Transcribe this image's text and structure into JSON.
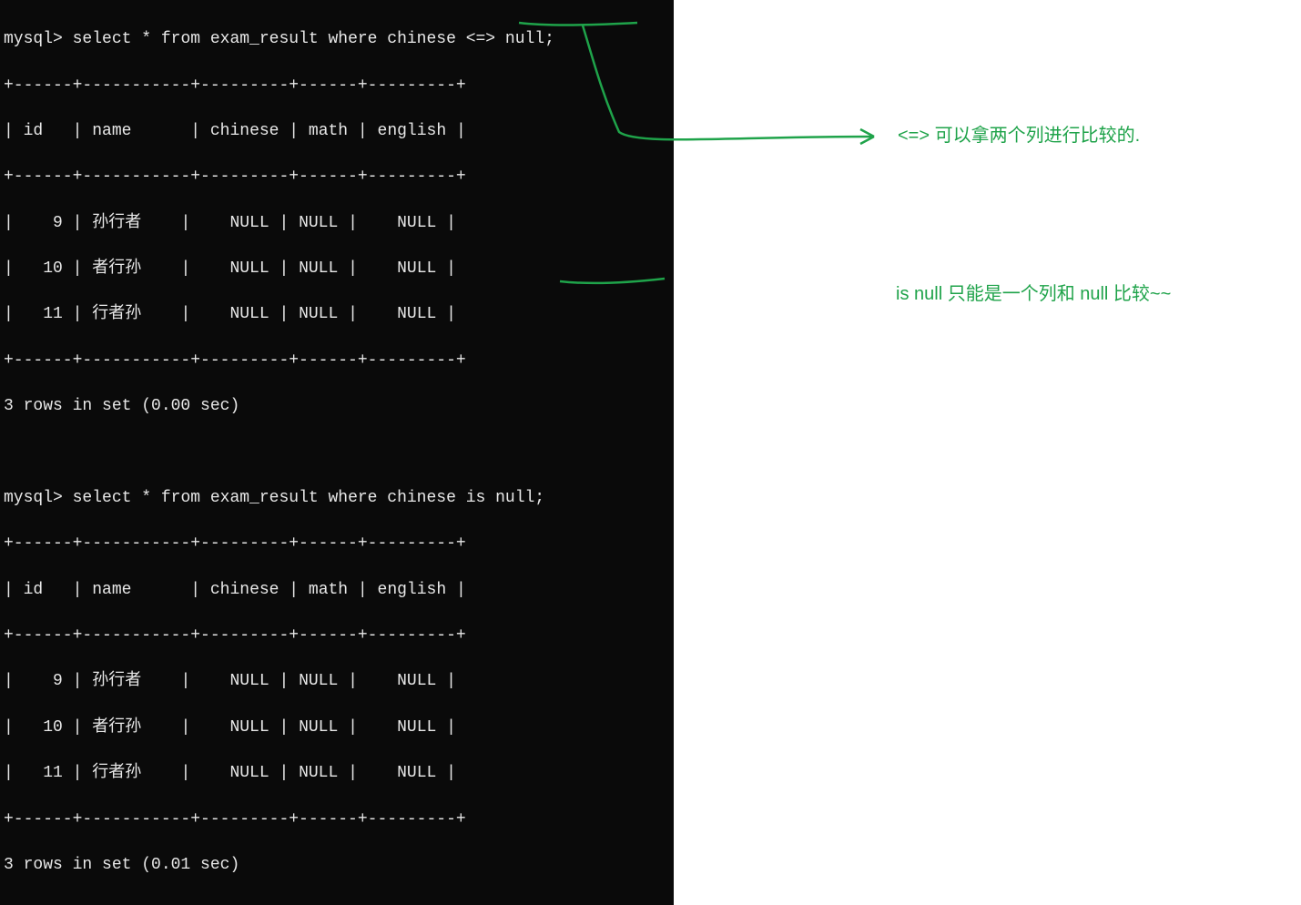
{
  "terminal": {
    "query1": {
      "prompt": "mysql> ",
      "sql": "select * from exam_result where chinese <=> null;",
      "header": [
        "id",
        "name",
        "chinese",
        "math",
        "english"
      ],
      "rows": [
        {
          "id": "9",
          "name": "孙行者",
          "chinese": "NULL",
          "math": "NULL",
          "english": "NULL"
        },
        {
          "id": "10",
          "name": "者行孙",
          "chinese": "NULL",
          "math": "NULL",
          "english": "NULL"
        },
        {
          "id": "11",
          "name": "行者孙",
          "chinese": "NULL",
          "math": "NULL",
          "english": "NULL"
        }
      ],
      "status": "3 rows in set (0.00 sec)"
    },
    "query2": {
      "prompt": "mysql> ",
      "sql": "select * from exam_result where chinese is null;",
      "header": [
        "id",
        "name",
        "chinese",
        "math",
        "english"
      ],
      "rows": [
        {
          "id": "9",
          "name": "孙行者",
          "chinese": "NULL",
          "math": "NULL",
          "english": "NULL"
        },
        {
          "id": "10",
          "name": "者行孙",
          "chinese": "NULL",
          "math": "NULL",
          "english": "NULL"
        },
        {
          "id": "11",
          "name": "行者孙",
          "chinese": "NULL",
          "math": "NULL",
          "english": "NULL"
        }
      ],
      "status": "3 rows in set (0.01 sec)"
    }
  },
  "annotations": {
    "note1": "<=> 可以拿两个列进行比较的.",
    "note2": "is null 只能是一个列和 null 比较~~"
  },
  "colors": {
    "terminal_bg": "#0a0a0a",
    "terminal_fg": "#e8e8e8",
    "annotation": "#1fa34a"
  }
}
